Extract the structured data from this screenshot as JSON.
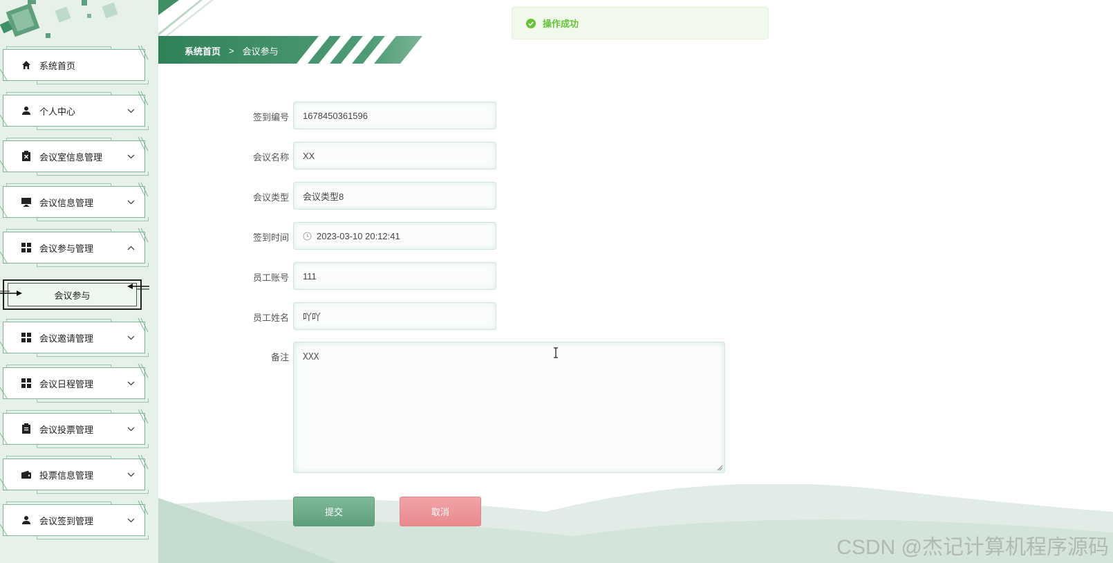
{
  "colors": {
    "brand": "#3f8f66",
    "accent_light": "#e6f1ea",
    "success": "#67c23a",
    "danger": "#e98a8e"
  },
  "sidebar": {
    "items": [
      {
        "label": "系统首页",
        "icon": "home-icon",
        "expanded": null
      },
      {
        "label": "个人中心",
        "icon": "user-icon",
        "expanded": false
      },
      {
        "label": "会议室信息管理",
        "icon": "clipboard-x-icon",
        "expanded": false
      },
      {
        "label": "会议信息管理",
        "icon": "monitor-icon",
        "expanded": false
      },
      {
        "label": "会议参与管理",
        "icon": "grid-icon",
        "expanded": true
      },
      {
        "label": "会议邀请管理",
        "icon": "grid-icon",
        "expanded": false
      },
      {
        "label": "会议日程管理",
        "icon": "grid-icon",
        "expanded": false
      },
      {
        "label": "会议投票管理",
        "icon": "clipboard-icon",
        "expanded": false
      },
      {
        "label": "投票信息管理",
        "icon": "wallet-icon",
        "expanded": false
      },
      {
        "label": "会议签到管理",
        "icon": "user-icon",
        "expanded": false
      }
    ],
    "sub_item": {
      "label": "会议参与",
      "active": true
    }
  },
  "breadcrumb": {
    "home": "系统首页",
    "separator": ">",
    "current": "会议参与"
  },
  "toast": {
    "message": "操作成功",
    "icon": "check-circle-icon"
  },
  "form": {
    "fields": [
      {
        "label": "签到编号",
        "value": "1678450361596"
      },
      {
        "label": "会议名称",
        "value": "XX"
      },
      {
        "label": "会议类型",
        "value": "会议类型8"
      },
      {
        "label": "签到时间",
        "value": "2023-03-10 20:12:41",
        "icon": "clock-icon"
      },
      {
        "label": "员工账号",
        "value": "111"
      },
      {
        "label": "员工姓名",
        "value": "吖吖"
      }
    ],
    "remark": {
      "label": "备注",
      "value": "XXX"
    },
    "submit_label": "提交",
    "cancel_label": "取消"
  },
  "watermark": "CSDN @杰记计算机程序源码"
}
